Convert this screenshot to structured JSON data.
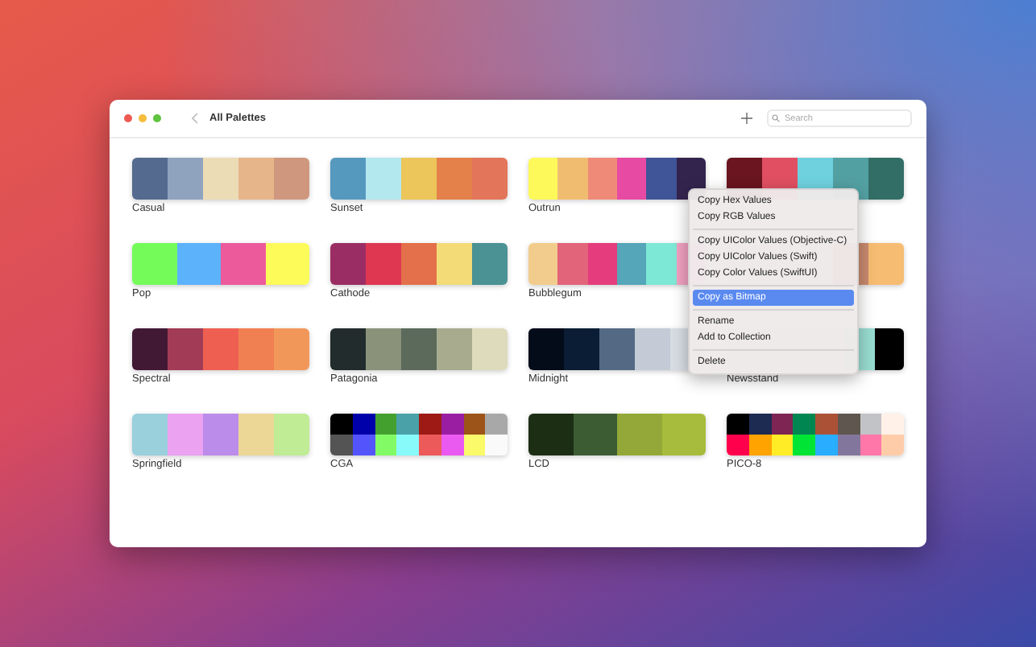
{
  "window": {
    "title": "All Palettes"
  },
  "search": {
    "placeholder": "Search"
  },
  "palettes": [
    {
      "name": "Casual",
      "rows": [
        [
          {
            "color": "#546a8e"
          },
          {
            "color": "#8fa3bf"
          },
          {
            "color": "#ecdcb6"
          },
          {
            "color": "#e6b68a"
          },
          {
            "color": "#cf977d"
          }
        ]
      ]
    },
    {
      "name": "Sunset",
      "rows": [
        [
          {
            "color": "#5699be"
          },
          {
            "color": "#b4e8ef"
          },
          {
            "color": "#ecc65a"
          },
          {
            "color": "#e4814a"
          },
          {
            "color": "#e2755a"
          }
        ]
      ]
    },
    {
      "name": "Outrun",
      "rows": [
        [
          {
            "color": "#fdf95a"
          },
          {
            "color": "#f0bd70"
          },
          {
            "color": "#ef8a78"
          },
          {
            "color": "#e74aa3"
          },
          {
            "color": "#3f5597"
          },
          {
            "color": "#33244e"
          }
        ]
      ]
    },
    {
      "rows": [
        [
          {
            "color": "#6a1520"
          },
          {
            "color": "#e05062"
          },
          {
            "color": "#6fd1de"
          },
          {
            "color": "#53a0a2"
          },
          {
            "color": "#336e66"
          }
        ]
      ]
    },
    {
      "name": "Pop",
      "rows": [
        [
          {
            "color": "#74fb5a"
          },
          {
            "color": "#5cb2fb"
          },
          {
            "color": "#ec5a9c"
          },
          {
            "color": "#fdfb5a"
          }
        ]
      ]
    },
    {
      "name": "Cathode",
      "rows": [
        [
          {
            "color": "#9a2e64"
          },
          {
            "color": "#df3751"
          },
          {
            "color": "#e3704a"
          },
          {
            "color": "#f3dc78"
          },
          {
            "color": "#4a9294"
          }
        ]
      ]
    },
    {
      "name": "Bubblegum",
      "rows": [
        [
          {
            "color": "#f2cc8c"
          },
          {
            "color": "#e2647a"
          },
          {
            "color": "#e43c7c"
          },
          {
            "color": "#54a6b8"
          },
          {
            "color": "#7ee8d6"
          },
          {
            "color": "#f0a0c0"
          }
        ]
      ]
    },
    {
      "rows": [
        [
          {},
          {},
          {},
          {
            "color": "#c88a70"
          },
          {
            "color": "#f6bc72"
          }
        ]
      ]
    },
    {
      "name": "Spectral",
      "rows": [
        [
          {
            "color": "#421935"
          },
          {
            "color": "#a23b55"
          },
          {
            "color": "#ee5f52"
          },
          {
            "color": "#f07f52"
          },
          {
            "color": "#f2975a"
          }
        ]
      ]
    },
    {
      "name": "Patagonia",
      "rows": [
        [
          {
            "color": "#232c2d"
          },
          {
            "color": "#8a927a"
          },
          {
            "color": "#5c6a5c"
          },
          {
            "color": "#a8ab8e"
          },
          {
            "color": "#dedbbc"
          }
        ]
      ]
    },
    {
      "name": "Midnight",
      "rows": [
        [
          {
            "color": "#040c1a"
          },
          {
            "color": "#0a1d35"
          },
          {
            "color": "#546a84"
          },
          {
            "color": "#c4cbd6"
          },
          {
            "color": "#d8dde4"
          }
        ]
      ]
    },
    {
      "name": "Newsstand",
      "rows": [
        [
          {},
          {},
          {},
          {},
          {
            "color": "#98dcd0"
          },
          {
            "color": "#000000"
          }
        ]
      ]
    },
    {
      "name": "Springfield",
      "rows": [
        [
          {
            "color": "#9acfdc"
          },
          {
            "color": "#eba2f1"
          },
          {
            "color": "#bb8ce9"
          },
          {
            "color": "#ecd797"
          },
          {
            "color": "#bfec95"
          }
        ]
      ]
    },
    {
      "name": "CGA",
      "rows": [
        [
          {
            "color": "#000000"
          },
          {
            "color": "#0000aa"
          },
          {
            "color": "#44a02e"
          },
          {
            "color": "#4aa2a8"
          },
          {
            "color": "#9e1a14"
          },
          {
            "color": "#9a1ea2"
          },
          {
            "color": "#9c5418"
          },
          {
            "color": "#a8a8a8"
          }
        ],
        [
          {
            "color": "#545454"
          },
          {
            "color": "#5454fc"
          },
          {
            "color": "#82fa66"
          },
          {
            "color": "#88fafa"
          },
          {
            "color": "#ec5a5a"
          },
          {
            "color": "#ea5af0"
          },
          {
            "color": "#fafa6a"
          },
          {
            "color": "#fafafa"
          }
        ]
      ]
    },
    {
      "name": "LCD",
      "rows": [
        [
          {
            "color": "#1c2e14"
          },
          {
            "color": "#3c5c34"
          },
          {
            "color": "#93a838"
          },
          {
            "color": "#a7bc3c"
          }
        ]
      ]
    },
    {
      "name": "PICO-8",
      "rows": [
        [
          {
            "color": "#000000"
          },
          {
            "color": "#1d2b53"
          },
          {
            "color": "#7e2553"
          },
          {
            "color": "#008751"
          },
          {
            "color": "#ab5236"
          },
          {
            "color": "#5f574f"
          },
          {
            "color": "#c2c3c7"
          },
          {
            "color": "#fff1e8"
          }
        ],
        [
          {
            "color": "#ff004d"
          },
          {
            "color": "#ffa300"
          },
          {
            "color": "#ffec27"
          },
          {
            "color": "#00e436"
          },
          {
            "color": "#29adff"
          },
          {
            "color": "#83769c"
          },
          {
            "color": "#ff77a8"
          },
          {
            "color": "#ffccaa"
          }
        ]
      ]
    }
  ],
  "context_menu": {
    "sections": [
      [
        {
          "label": "Copy Hex Values",
          "selected": false
        },
        {
          "label": "Copy RGB Values",
          "selected": false
        }
      ],
      [
        {
          "label": "Copy UIColor Values (Objective-C)",
          "selected": false
        },
        {
          "label": "Copy UIColor Values (Swift)",
          "selected": false
        },
        {
          "label": "Copy Color Values (SwiftUI)",
          "selected": false
        }
      ],
      [
        {
          "label": "Copy as Bitmap",
          "selected": true
        }
      ],
      [
        {
          "label": "Rename",
          "selected": false
        },
        {
          "label": "Add to Collection",
          "selected": false
        }
      ],
      [
        {
          "label": "Delete",
          "selected": false
        }
      ]
    ]
  }
}
